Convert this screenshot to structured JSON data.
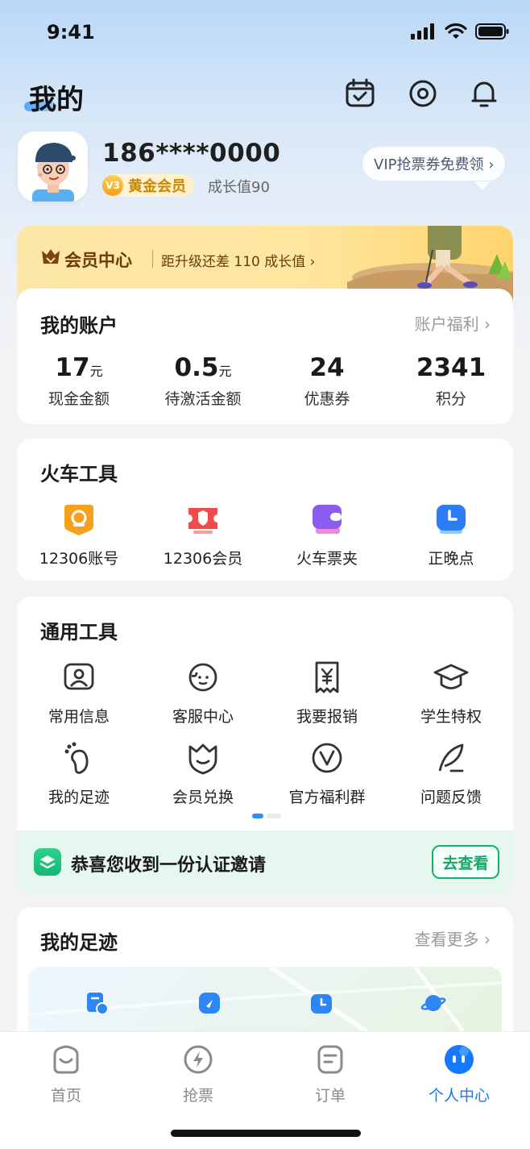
{
  "status_bar": {
    "time": "9:41"
  },
  "header": {
    "title": "我的"
  },
  "profile": {
    "phone": "186****0000",
    "level_badge": "V3",
    "level_name": "黄金会员",
    "growth": "成长值90",
    "vip_bubble": "VIP抢票券免费领 ›"
  },
  "member_banner": {
    "title": "会员中心",
    "desc": "距升级还差 110 成长值 ›"
  },
  "account": {
    "title": "我的账户",
    "more": "账户福利 ›",
    "stats": [
      {
        "value": "17",
        "unit": "元",
        "label": "现金金额"
      },
      {
        "value": "0.5",
        "unit": "元",
        "label": "待激活金额"
      },
      {
        "value": "24",
        "unit": "",
        "label": "优惠券"
      },
      {
        "value": "2341",
        "unit": "",
        "label": "积分"
      }
    ]
  },
  "train_tools": {
    "title": "火车工具",
    "items": [
      {
        "label": "12306账号",
        "icon": "railway-logo-icon"
      },
      {
        "label": "12306会员",
        "icon": "member-ticket-icon"
      },
      {
        "label": "火车票夹",
        "icon": "wallet-icon"
      },
      {
        "label": "正晚点",
        "icon": "clock-icon"
      }
    ]
  },
  "general_tools": {
    "title": "通用工具",
    "items": [
      {
        "label": "常用信息",
        "icon": "contact-card-icon"
      },
      {
        "label": "客服中心",
        "icon": "customer-service-icon"
      },
      {
        "label": "我要报销",
        "icon": "receipt-icon"
      },
      {
        "label": "学生特权",
        "icon": "graduation-cap-icon"
      },
      {
        "label": "我的足迹",
        "icon": "footprint-icon"
      },
      {
        "label": "会员兑换",
        "icon": "shield-crown-icon"
      },
      {
        "label": "官方福利群",
        "icon": "group-check-icon"
      },
      {
        "label": "问题反馈",
        "icon": "feather-icon"
      }
    ]
  },
  "invite": {
    "text": "恭喜您收到一份认证邀请",
    "button": "去查看"
  },
  "footprint": {
    "title": "我的足迹",
    "more": "查看更多 ›"
  },
  "tabbar": {
    "items": [
      {
        "label": "首页",
        "active": false
      },
      {
        "label": "抢票",
        "active": false
      },
      {
        "label": "订单",
        "active": false
      },
      {
        "label": "个人中心",
        "active": true
      }
    ]
  },
  "colors": {
    "accent": "#1677ff",
    "gold": "#c98a00",
    "green": "#17b36e"
  }
}
